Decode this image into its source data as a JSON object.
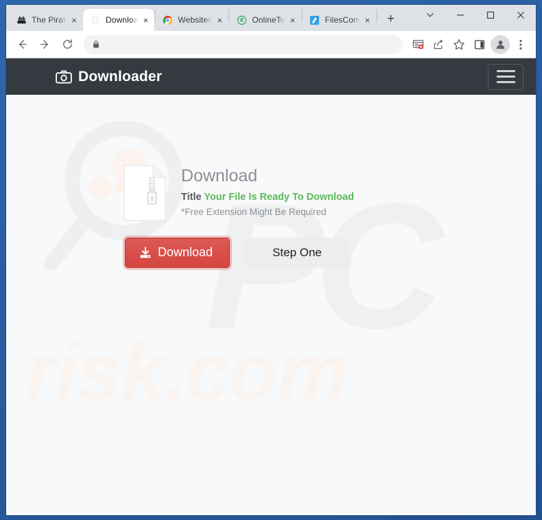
{
  "browser": {
    "tabs": [
      {
        "title": "The Pirate",
        "favicon": "pirate-ship-icon",
        "active": false
      },
      {
        "title": "Downloa",
        "favicon": "document-icon",
        "active": true
      },
      {
        "title": "Websites",
        "favicon": "chrome-icon",
        "active": false
      },
      {
        "title": "OnlineTo",
        "favicon": "spiral-green-icon",
        "active": false
      },
      {
        "title": "FilesConv",
        "favicon": "blue-arrow-icon",
        "active": false
      }
    ],
    "new_tab_label": "+",
    "tab_close_label": "×",
    "window_controls": {
      "tab_search": "∨",
      "minimize": "–",
      "maximize": "□",
      "close": "×"
    },
    "toolbar": {
      "back_label": "←",
      "forward_label": "→",
      "reload_label": "↻",
      "url_value": "",
      "url_placeholder": "",
      "lock_icon": "lock-icon",
      "actions": [
        "popup-blocked-icon",
        "share-icon",
        "bookmark-star-icon",
        "side-panel-icon",
        "profile-avatar-icon",
        "three-dot-menu-icon"
      ]
    }
  },
  "page": {
    "navbar": {
      "brand": "Downloader",
      "brand_icon": "camera-icon",
      "toggle_icon": "hamburger-icon"
    },
    "watermarks": {
      "pc": "PC",
      "risk": "risk.com",
      "magnifier": "magnifier-watermark"
    },
    "download": {
      "file_icon": "zip-file-icon",
      "heading": "Download",
      "title_label": "Title",
      "ready_text": "Your File Is Ready To Download",
      "extension_note": "*Free Extension Might Be Required",
      "download_button": "Download",
      "download_button_icon": "download-arrow-icon",
      "step_button": "Step One"
    }
  },
  "colors": {
    "navbar_bg": "#343a40",
    "page_bg": "#f8f9fa",
    "accent_red": "#d9534f",
    "accent_green": "#5cb85c",
    "frame_blue": "#2b5797"
  }
}
